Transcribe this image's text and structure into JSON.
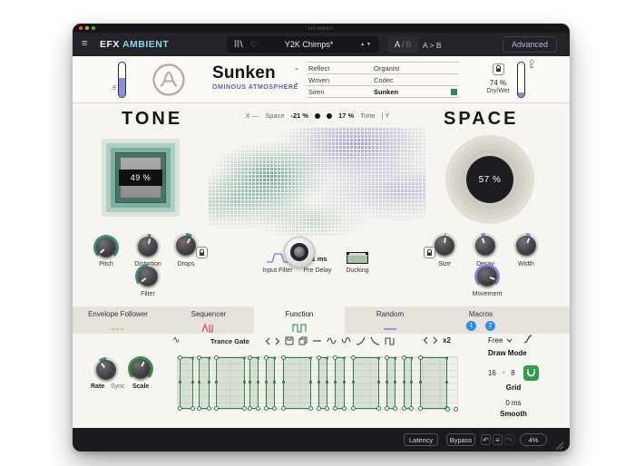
{
  "titlebar": {
    "text": "EFX AMBIENT"
  },
  "toolbar": {
    "menu": "≡",
    "app_efx": "EFX",
    "app_ambient": "AMBIENT",
    "heart": "♡",
    "preset_name": "Y2K Chimps*",
    "nav_arrows": "▲▼",
    "ab_a": "A",
    "ab_sep": "/",
    "ab_b": "B",
    "ab_copy": "A > B",
    "advanced": "Advanced"
  },
  "header": {
    "title": "Sunken",
    "subtitle": "OMINOUS ATMOSPHERE",
    "chev_up": "⌃",
    "chev_down": "⌄",
    "list_left": [
      "Reflect",
      "Woven",
      "Siren"
    ],
    "list_right": [
      "Organist",
      "Codec",
      "Sunken"
    ],
    "in_label": "In",
    "out_label": "Out",
    "drywet_value": "74 %",
    "drywet_label": "Dry/Wet"
  },
  "main": {
    "tone_title": "TONE",
    "space_title": "SPACE",
    "x_label": "X —",
    "space_param": "Space",
    "space_value": "-21 %",
    "tone_value": "17 %",
    "tone_param": "Tone",
    "y_label": "| Y",
    "tone_knob_value": "49 %",
    "space_knob_value": "57 %",
    "input_filter_label": "Input Filter",
    "pre_delay_value": "41 ms",
    "pre_delay_label": "Pre Delay",
    "ducking_label": "Ducking"
  },
  "knobs": [
    {
      "id": "pitch",
      "label": "Pitch",
      "angle": -132,
      "ring": [
        -135,
        135
      ],
      "color": "#3e907c"
    },
    {
      "id": "distortion",
      "label": "Distortion",
      "angle": 15,
      "ring": [
        0,
        15
      ],
      "color": "#3e907c"
    },
    {
      "id": "drops",
      "label": "Drops",
      "angle": 30,
      "ring": [
        0,
        30
      ],
      "color": "#3e907c"
    },
    {
      "id": "filter",
      "label": "Filter",
      "angle": -128,
      "ring": [
        -128,
        0
      ],
      "color": "#3e907c"
    },
    {
      "id": "size",
      "label": "Size",
      "angle": 5,
      "ring": [
        0,
        8
      ],
      "color": "#8a8fd6"
    },
    {
      "id": "decay",
      "label": "Decay",
      "angle": -22,
      "ring": [
        -22,
        0
      ],
      "color": "#8a8fd6"
    },
    {
      "id": "width",
      "label": "Width",
      "angle": 22,
      "ring": [
        0,
        22
      ],
      "color": "#8a8fd6"
    },
    {
      "id": "movement",
      "label": "Movement",
      "angle": 110,
      "ring": [
        -135,
        135
      ],
      "color": "#8a8fd6"
    },
    {
      "id": "rate",
      "label": "Rate",
      "angle": -35,
      "ring": [
        -35,
        0
      ],
      "color": "#3f9151"
    },
    {
      "id": "scale",
      "label": "Scale",
      "angle": 25,
      "ring": [
        -135,
        135
      ],
      "color": "#3f9151"
    }
  ],
  "tabs": [
    {
      "label": "Envelope Follower",
      "active": false
    },
    {
      "label": "Sequencer",
      "active": false
    },
    {
      "label": "Function",
      "active": true
    },
    {
      "label": "Random",
      "active": false
    },
    {
      "label": "Macros",
      "active": false
    }
  ],
  "macro_badges": [
    "1",
    "2"
  ],
  "function_panel": {
    "name": "Trance Gate",
    "multiply": "x2",
    "draw_mode_value": "Free",
    "draw_mode_label": "Draw Mode",
    "grid_cols": "16",
    "grid_sep": "×",
    "grid_rows": "8",
    "grid_label": "Grid",
    "smooth_value": "0 ms",
    "smooth_label": "Smooth",
    "rate_label": "Rate",
    "sync_label": "Sync",
    "scale_label": "Scale",
    "gates": [
      [
        0.5,
        5.4
      ],
      [
        7.6,
        11.4
      ],
      [
        13.6,
        23.9
      ],
      [
        25.5,
        28.8
      ],
      [
        31.5,
        34.8
      ],
      [
        37.8,
        47.6
      ],
      [
        50.2,
        53.5
      ],
      [
        56.3,
        59.6
      ],
      [
        62.5,
        72.0
      ],
      [
        74.8,
        78.0
      ],
      [
        80.7,
        83.9
      ],
      [
        86.8,
        96.5
      ]
    ],
    "tail": [
      96.7,
      99.5
    ]
  },
  "bottombar": {
    "latency": "Latency",
    "bypass": "Bypass",
    "cpu": "4%",
    "undo": "↶",
    "redo": "↷",
    "history": "≡"
  },
  "colors": {
    "accent_teal": "#3e907c",
    "accent_purple": "#8a8fd6",
    "accent_green": "#2e8047",
    "tab_yellow": "#e0b53e",
    "tab_red": "#cf5a70",
    "tab_green": "#4a9e5c",
    "tab_purple": "#9a94d8",
    "macro_blue": "#2b8ceb",
    "ambient_blue": "#8fd4e8",
    "selected_green": "#2f8a56"
  }
}
